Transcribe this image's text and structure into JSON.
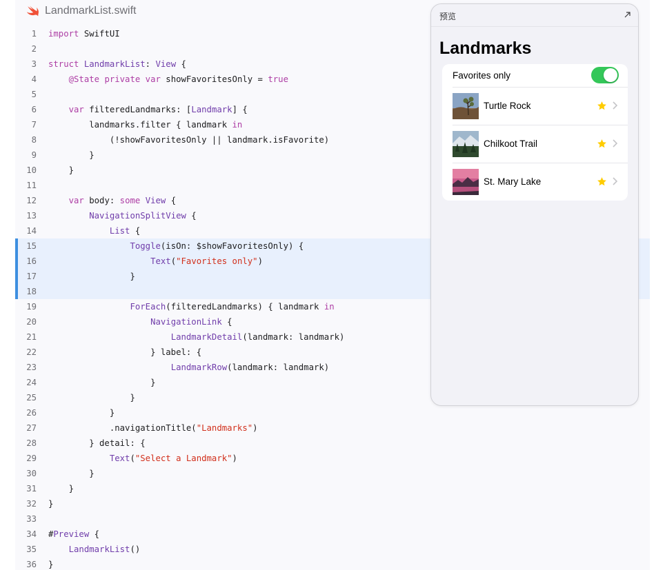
{
  "file": {
    "name": "LandmarkList.swift",
    "icon": "swift-icon"
  },
  "code": {
    "highlight_lines": [
      15,
      16,
      17,
      18
    ],
    "colors": {
      "keyword": "#ad3da4",
      "type": "#703daa",
      "string": "#d12f1b",
      "highlight_bg": "#e8f0fd",
      "highlight_bar": "#3d8fe0"
    },
    "lines": [
      {
        "n": "1",
        "tokens": [
          [
            "kw",
            "import"
          ],
          [
            "p",
            " SwiftUI"
          ]
        ]
      },
      {
        "n": "2",
        "tokens": []
      },
      {
        "n": "3",
        "tokens": [
          [
            "kw",
            "struct"
          ],
          [
            "p",
            " "
          ],
          [
            "type",
            "LandmarkList"
          ],
          [
            "p",
            ": "
          ],
          [
            "type",
            "View"
          ],
          [
            "p",
            " {"
          ]
        ]
      },
      {
        "n": "4",
        "tokens": [
          [
            "p",
            "    "
          ],
          [
            "kw",
            "@State private var"
          ],
          [
            "p",
            " showFavoritesOnly = "
          ],
          [
            "kw",
            "true"
          ]
        ]
      },
      {
        "n": "5",
        "tokens": []
      },
      {
        "n": "6",
        "tokens": [
          [
            "p",
            "    "
          ],
          [
            "kw",
            "var"
          ],
          [
            "p",
            " filteredLandmarks: ["
          ],
          [
            "type",
            "Landmark"
          ],
          [
            "p",
            "] {"
          ]
        ]
      },
      {
        "n": "7",
        "tokens": [
          [
            "p",
            "        landmarks.filter { landmark "
          ],
          [
            "kw",
            "in"
          ]
        ]
      },
      {
        "n": "8",
        "tokens": [
          [
            "p",
            "            (!showFavoritesOnly || landmark.isFavorite)"
          ]
        ]
      },
      {
        "n": "9",
        "tokens": [
          [
            "p",
            "        }"
          ]
        ]
      },
      {
        "n": "10",
        "tokens": [
          [
            "p",
            "    }"
          ]
        ]
      },
      {
        "n": "11",
        "tokens": []
      },
      {
        "n": "12",
        "tokens": [
          [
            "p",
            "    "
          ],
          [
            "kw",
            "var"
          ],
          [
            "p",
            " body: "
          ],
          [
            "kw",
            "some"
          ],
          [
            "p",
            " "
          ],
          [
            "type",
            "View"
          ],
          [
            "p",
            " {"
          ]
        ]
      },
      {
        "n": "13",
        "tokens": [
          [
            "p",
            "        "
          ],
          [
            "type",
            "NavigationSplitView"
          ],
          [
            "p",
            " {"
          ]
        ]
      },
      {
        "n": "14",
        "tokens": [
          [
            "p",
            "            "
          ],
          [
            "type",
            "List"
          ],
          [
            "p",
            " {"
          ]
        ]
      },
      {
        "n": "15",
        "tokens": [
          [
            "p",
            "                "
          ],
          [
            "type",
            "Toggle"
          ],
          [
            "p",
            "(isOn: $showFavoritesOnly) {"
          ]
        ]
      },
      {
        "n": "16",
        "tokens": [
          [
            "p",
            "                    "
          ],
          [
            "type",
            "Text"
          ],
          [
            "p",
            "("
          ],
          [
            "str",
            "\"Favorites only\""
          ],
          [
            "p",
            ")"
          ]
        ]
      },
      {
        "n": "17",
        "tokens": [
          [
            "p",
            "                }"
          ]
        ]
      },
      {
        "n": "18",
        "tokens": []
      },
      {
        "n": "19",
        "tokens": [
          [
            "p",
            "                "
          ],
          [
            "type",
            "ForEach"
          ],
          [
            "p",
            "(filteredLandmarks) { landmark "
          ],
          [
            "kw",
            "in"
          ]
        ]
      },
      {
        "n": "20",
        "tokens": [
          [
            "p",
            "                    "
          ],
          [
            "type",
            "NavigationLink"
          ],
          [
            "p",
            " {"
          ]
        ]
      },
      {
        "n": "21",
        "tokens": [
          [
            "p",
            "                        "
          ],
          [
            "type",
            "LandmarkDetail"
          ],
          [
            "p",
            "(landmark: landmark)"
          ]
        ]
      },
      {
        "n": "22",
        "tokens": [
          [
            "p",
            "                    } label: {"
          ]
        ]
      },
      {
        "n": "23",
        "tokens": [
          [
            "p",
            "                        "
          ],
          [
            "type",
            "LandmarkRow"
          ],
          [
            "p",
            "(landmark: landmark)"
          ]
        ]
      },
      {
        "n": "24",
        "tokens": [
          [
            "p",
            "                    }"
          ]
        ]
      },
      {
        "n": "25",
        "tokens": [
          [
            "p",
            "                }"
          ]
        ]
      },
      {
        "n": "26",
        "tokens": [
          [
            "p",
            "            }"
          ]
        ]
      },
      {
        "n": "27",
        "tokens": [
          [
            "p",
            "            .navigationTitle("
          ],
          [
            "str",
            "\"Landmarks\""
          ],
          [
            "p",
            ")"
          ]
        ]
      },
      {
        "n": "28",
        "tokens": [
          [
            "p",
            "        } detail: {"
          ]
        ]
      },
      {
        "n": "29",
        "tokens": [
          [
            "p",
            "            "
          ],
          [
            "type",
            "Text"
          ],
          [
            "p",
            "("
          ],
          [
            "str",
            "\"Select a Landmark\""
          ],
          [
            "p",
            ")"
          ]
        ]
      },
      {
        "n": "30",
        "tokens": [
          [
            "p",
            "        }"
          ]
        ]
      },
      {
        "n": "31",
        "tokens": [
          [
            "p",
            "    }"
          ]
        ]
      },
      {
        "n": "32",
        "tokens": [
          [
            "p",
            "}"
          ]
        ]
      },
      {
        "n": "33",
        "tokens": []
      },
      {
        "n": "34",
        "tokens": [
          [
            "p",
            "#"
          ],
          [
            "type",
            "Preview"
          ],
          [
            "p",
            " {"
          ]
        ]
      },
      {
        "n": "35",
        "tokens": [
          [
            "p",
            "    "
          ],
          [
            "type",
            "LandmarkList"
          ],
          [
            "p",
            "()"
          ]
        ]
      },
      {
        "n": "36",
        "tokens": [
          [
            "p",
            "}"
          ]
        ]
      }
    ]
  },
  "preview": {
    "label": "预览",
    "expand_icon": "expand-arrow-icon",
    "nav_title": "Landmarks",
    "toggle": {
      "label": "Favorites only",
      "on": true,
      "color": "#34c759"
    },
    "landmarks": [
      {
        "name": "Turtle Rock",
        "favorite": true,
        "thumb": "turtle-rock-thumbnail"
      },
      {
        "name": "Chilkoot Trail",
        "favorite": true,
        "thumb": "chilkoot-trail-thumbnail"
      },
      {
        "name": "St. Mary Lake",
        "favorite": true,
        "thumb": "st-mary-lake-thumbnail"
      }
    ],
    "star_color": "#ffcc00"
  }
}
